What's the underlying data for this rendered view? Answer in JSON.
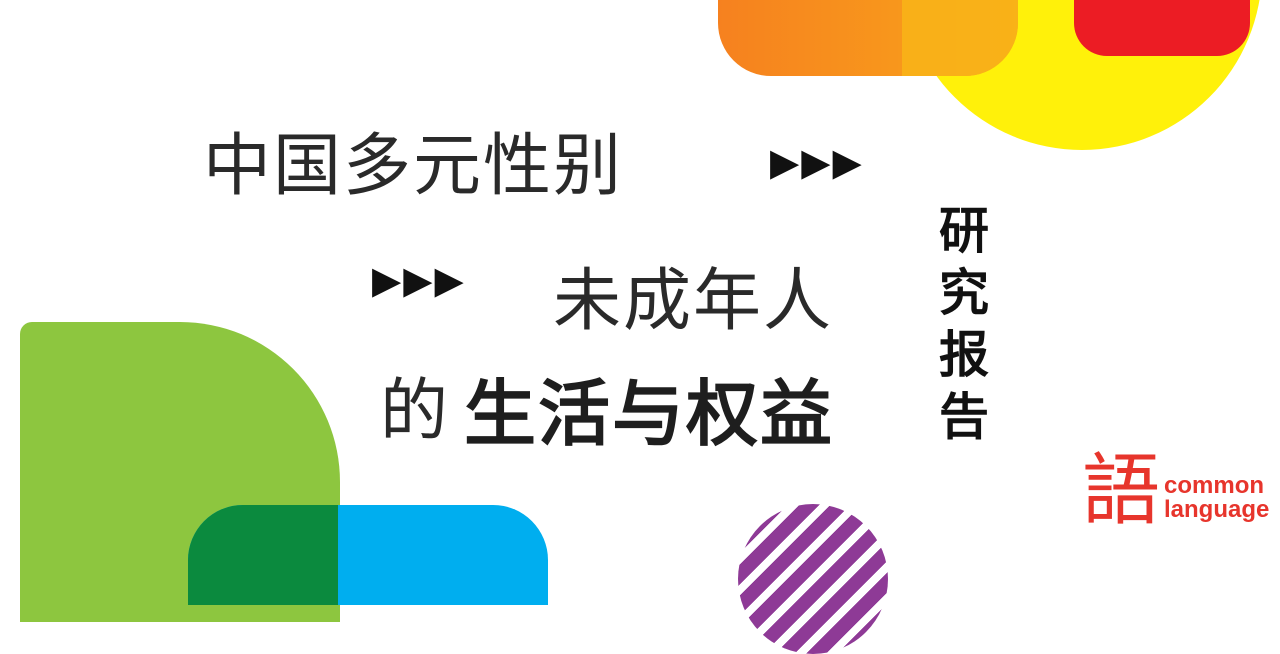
{
  "headline": {
    "line1": "中国多元性别",
    "line2": "未成年人",
    "line3_prefix": "的",
    "line3_bold": "生活与权益",
    "arrows": "▶▶▶"
  },
  "side_label": [
    "研",
    "究",
    "报",
    "告"
  ],
  "logo": {
    "char": "語",
    "word1": "common",
    "word2": "language"
  },
  "colors": {
    "orange": "#f6811f",
    "yellow": "#fff10a",
    "red": "#ec1c24",
    "green": "#8dc63f",
    "blue": "#00aeef",
    "dark_green": "#0b8a3e",
    "purple": "#8e3a96",
    "logo_red": "#e7352c"
  }
}
